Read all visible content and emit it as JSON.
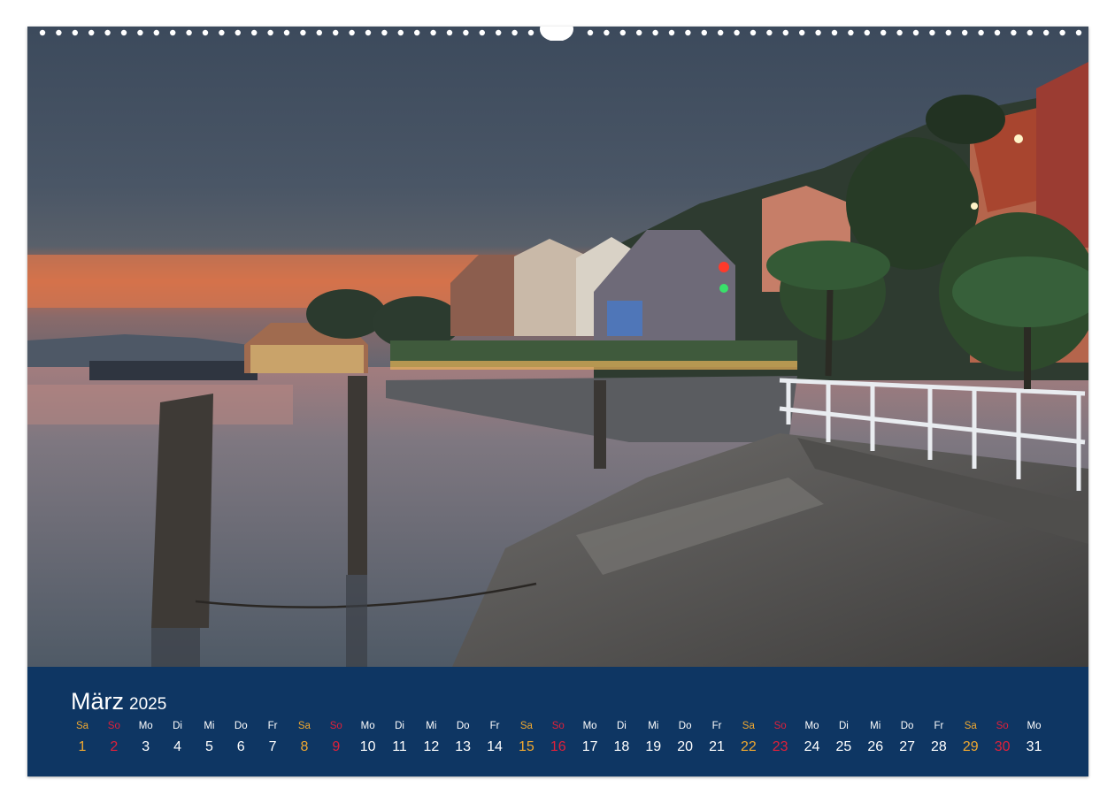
{
  "calendar": {
    "month": "März",
    "year": "2025",
    "days": [
      {
        "wd": "Sa",
        "d": "1",
        "t": "sat"
      },
      {
        "wd": "So",
        "d": "2",
        "t": "sun"
      },
      {
        "wd": "Mo",
        "d": "3",
        "t": "wk"
      },
      {
        "wd": "Di",
        "d": "4",
        "t": "wk"
      },
      {
        "wd": "Mi",
        "d": "5",
        "t": "wk"
      },
      {
        "wd": "Do",
        "d": "6",
        "t": "wk"
      },
      {
        "wd": "Fr",
        "d": "7",
        "t": "wk"
      },
      {
        "wd": "Sa",
        "d": "8",
        "t": "sat"
      },
      {
        "wd": "So",
        "d": "9",
        "t": "sun"
      },
      {
        "wd": "Mo",
        "d": "10",
        "t": "wk"
      },
      {
        "wd": "Di",
        "d": "11",
        "t": "wk"
      },
      {
        "wd": "Mi",
        "d": "12",
        "t": "wk"
      },
      {
        "wd": "Do",
        "d": "13",
        "t": "wk"
      },
      {
        "wd": "Fr",
        "d": "14",
        "t": "wk"
      },
      {
        "wd": "Sa",
        "d": "15",
        "t": "sat"
      },
      {
        "wd": "So",
        "d": "16",
        "t": "sun"
      },
      {
        "wd": "Mo",
        "d": "17",
        "t": "wk"
      },
      {
        "wd": "Di",
        "d": "18",
        "t": "wk"
      },
      {
        "wd": "Mi",
        "d": "19",
        "t": "wk"
      },
      {
        "wd": "Do",
        "d": "20",
        "t": "wk"
      },
      {
        "wd": "Fr",
        "d": "21",
        "t": "wk"
      },
      {
        "wd": "Sa",
        "d": "22",
        "t": "sat"
      },
      {
        "wd": "So",
        "d": "23",
        "t": "sun"
      },
      {
        "wd": "Mo",
        "d": "24",
        "t": "wk"
      },
      {
        "wd": "Di",
        "d": "25",
        "t": "wk"
      },
      {
        "wd": "Mi",
        "d": "26",
        "t": "wk"
      },
      {
        "wd": "Do",
        "d": "27",
        "t": "wk"
      },
      {
        "wd": "Fr",
        "d": "28",
        "t": "wk"
      },
      {
        "wd": "Sa",
        "d": "29",
        "t": "sat"
      },
      {
        "wd": "So",
        "d": "30",
        "t": "sun"
      },
      {
        "wd": "Mo",
        "d": "31",
        "t": "wk"
      }
    ]
  },
  "colors": {
    "band": "#0e3663",
    "saturday": "#f0a830",
    "sunday": "#e0203a",
    "weekday": "#ffffff"
  }
}
